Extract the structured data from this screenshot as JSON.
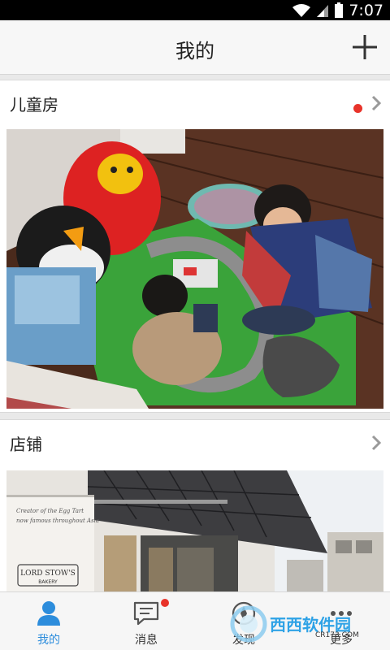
{
  "status_bar": {
    "time": "7:07",
    "icons": [
      "wifi-icon",
      "signal-icon",
      "battery-icon"
    ]
  },
  "header": {
    "title": "我的",
    "add_icon": "plus-icon"
  },
  "cards": [
    {
      "title": "儿童房",
      "has_new": true,
      "chevron": "chevron-right-icon"
    },
    {
      "title": "店铺",
      "has_new": false,
      "chevron": "chevron-right-icon",
      "sign_text": "LORD STOW'S",
      "sign_sub": "BAKERY"
    }
  ],
  "bottom_nav": {
    "tabs": [
      {
        "label": "我的",
        "icon": "person-icon",
        "active": true
      },
      {
        "label": "消息",
        "icon": "message-icon",
        "badge": true
      },
      {
        "label": "发现",
        "icon": "discover-icon"
      },
      {
        "label": "更多",
        "icon": "more-icon"
      }
    ]
  },
  "watermark": {
    "text": "西西软件园",
    "sub": "CR173.COM"
  },
  "colors": {
    "accent": "#2d8ddc",
    "badge": "#e8332a",
    "header_bg": "#f7f7f7",
    "page_bg": "#e9e9e9"
  }
}
